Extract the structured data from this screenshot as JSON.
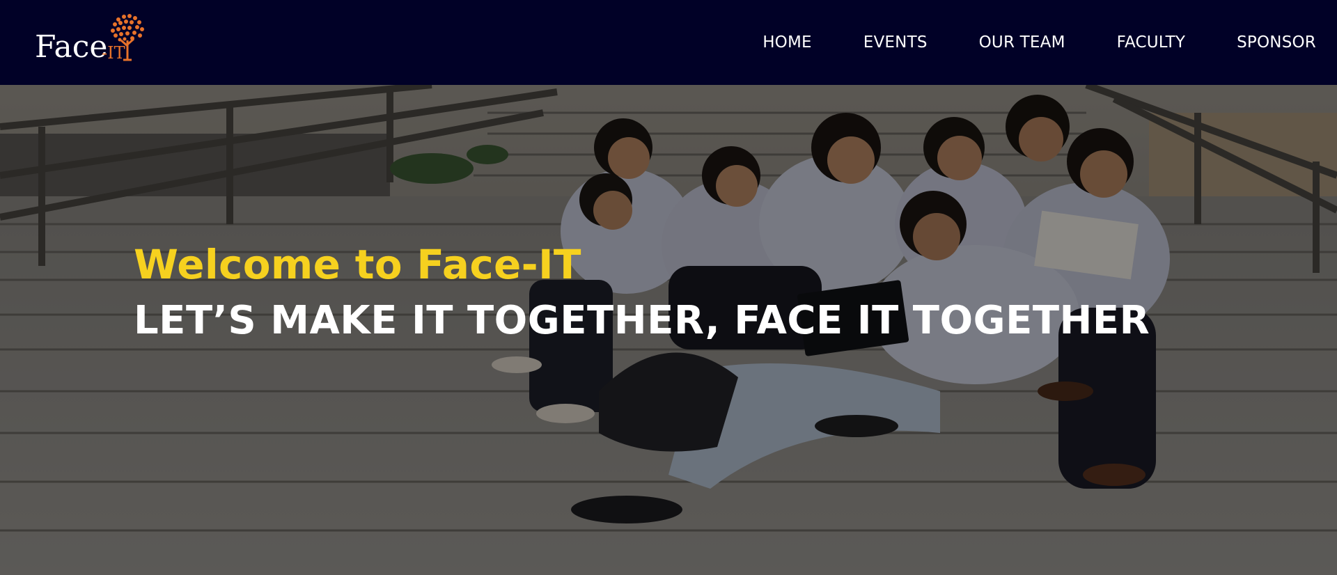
{
  "brand": {
    "logo_text_left": "Face",
    "logo_text_right": "-IT",
    "logo_alt": "Face-IT"
  },
  "nav": {
    "items": [
      {
        "label": "HOME"
      },
      {
        "label": "EVENTS"
      },
      {
        "label": "OUR TEAM"
      },
      {
        "label": "FACULTY"
      },
      {
        "label": "SPONSOR"
      }
    ]
  },
  "hero": {
    "welcome": "Welcome to Face-IT",
    "tagline": "LET’S MAKE IT TOGETHER, FACE IT TOGETHER"
  },
  "colors": {
    "navbar_bg": "#010127",
    "accent_yellow": "#f6d11f",
    "logo_orange": "#e8722a",
    "text_white": "#ffffff"
  }
}
